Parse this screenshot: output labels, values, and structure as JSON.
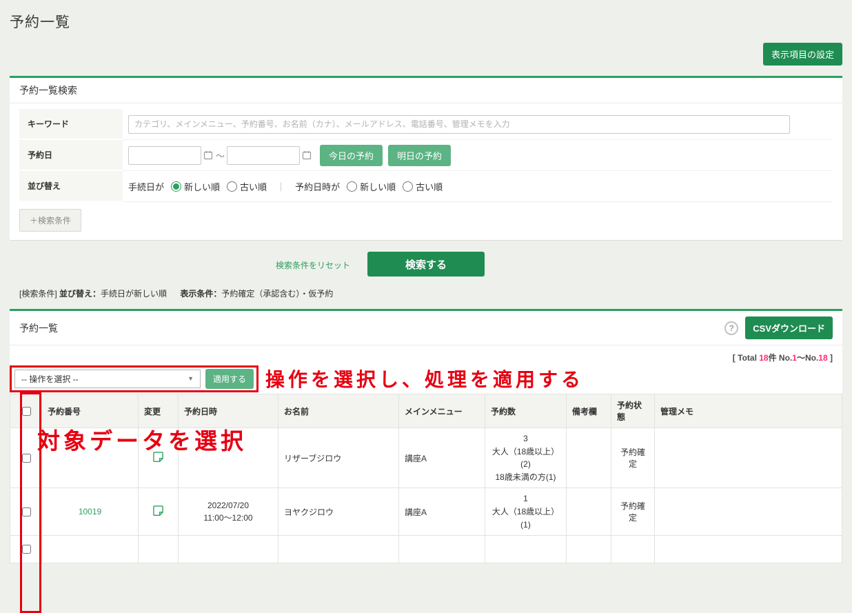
{
  "page_title": "予約一覧",
  "colors": {
    "green_dark": "#1f8c52",
    "green_mid": "#5cb383",
    "green_accent_border": "#2ba05f",
    "pink_total": "#ff2d6e",
    "annotation_red": "#e60012"
  },
  "toolbar": {
    "display_settings_label": "表示項目の設定"
  },
  "icons": {
    "help": "?",
    "select_arrow": "▼"
  },
  "search_panel": {
    "title": "予約一覧検索",
    "keyword_label": "キーワード",
    "keyword_placeholder": "カテゴリ、メインメニュー、予約番号、お名前（カナ）、メールアドレス、電話番号、管理メモを入力",
    "date_label": "予約日",
    "date_separator": "～",
    "today_button": "今日の予約",
    "tomorrow_button": "明日の予約",
    "sort_label": "並び替え",
    "sort_group1_label": "手続日が",
    "sort_group1_option1": "新しい順",
    "sort_group1_option2": "古い順",
    "sort_divider": "｜",
    "sort_group2_label": "予約日時が",
    "sort_group2_option1": "新しい順",
    "sort_group2_option2": "古い順",
    "more_conditions_button": "＋検索条件",
    "reset_link": "検索条件をリセット",
    "submit_button": "検索する"
  },
  "conditions_summary": {
    "prefix": "[検索条件]",
    "sort_label": "並び替え：",
    "sort_value": "手続日が新しい順",
    "display_label": "表示条件：",
    "display_value": "予約確定（承認含む）・仮予約"
  },
  "list_panel": {
    "title": "予約一覧",
    "csv_button": "CSVダウンロード",
    "total": {
      "prefix": "[ Total ",
      "count": "18",
      "mid": "件 No.",
      "from": "1",
      "tilde": "～No.",
      "to": "18",
      "suffix": " ]"
    },
    "bulk": {
      "select_value": "-- 操作を選択 --",
      "apply_button": "適用する"
    },
    "annotations": {
      "bulk_note": "操作を選択し、処理を適用する",
      "select_note": "対象データを選択"
    },
    "table": {
      "columns": [
        "予約番号",
        "変更",
        "予約日時",
        "お名前",
        "メインメニュー",
        "予約数",
        "備考欄",
        "予約状態",
        "管理メモ"
      ],
      "rows": [
        {
          "number": "",
          "date1": "",
          "date2": "",
          "name": "リザーブジロウ",
          "menu": "講座A",
          "count": "3",
          "count_detail1": "大人（18歳以上）(2)",
          "count_detail2": "18歳未満の方(1)",
          "note": "",
          "status": "予約確定",
          "memo": ""
        },
        {
          "number": "10019",
          "date1": "2022/07/20",
          "date2": "11:00～12:00",
          "name": "ヨヤクジロウ",
          "menu": "講座A",
          "count": "1",
          "count_detail1": "大人（18歳以上）(1)",
          "count_detail2": "",
          "note": "",
          "status": "予約確定",
          "memo": ""
        }
      ]
    }
  }
}
